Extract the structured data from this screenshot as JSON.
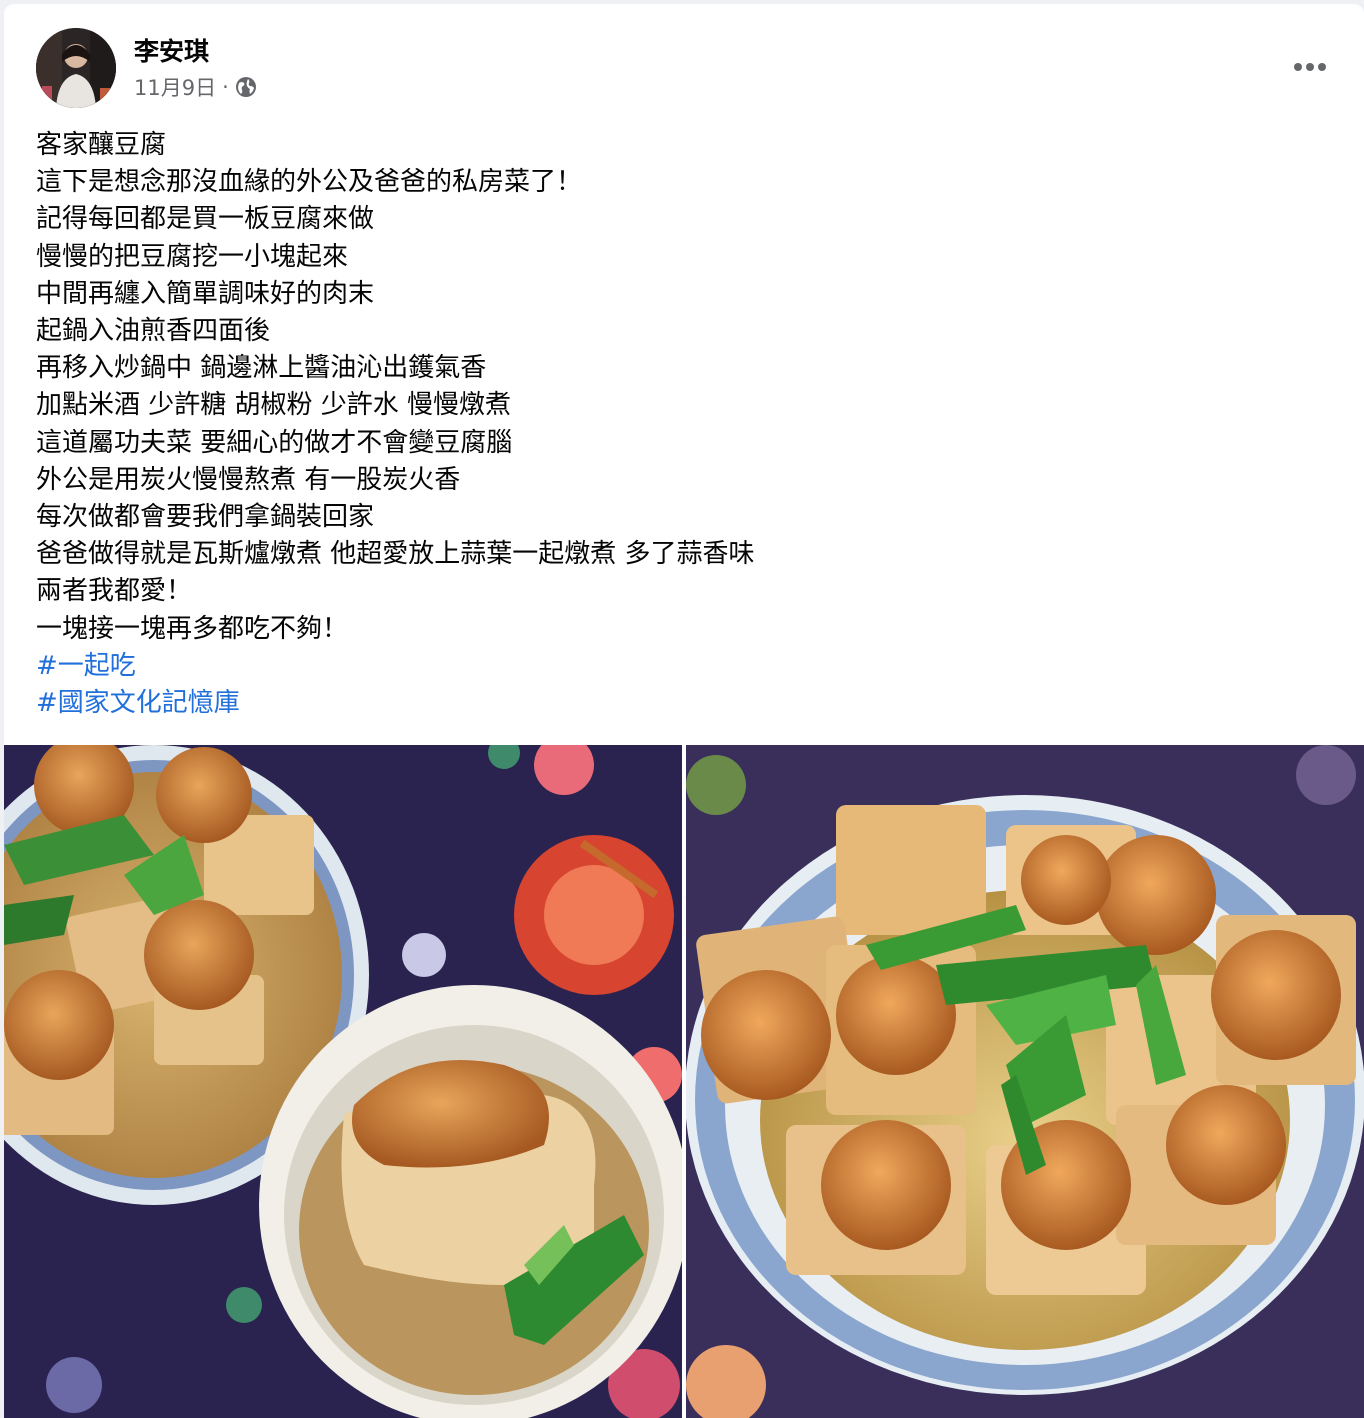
{
  "post": {
    "author": "李安琪",
    "date": "11月9日",
    "separator": "·",
    "privacy_icon": "globe-icon",
    "more_icon": "more-options-icon",
    "lines": [
      "客家釀豆腐",
      "這下是想念那沒血緣的外公及爸爸的私房菜了！",
      "記得每回都是買一板豆腐來做",
      "慢慢的把豆腐挖一小塊起來",
      "中間再纏入簡單調味好的肉末",
      "起鍋入油煎香四面後",
      "再移入炒鍋中 鍋邊淋上醬油沁出鑊氣香",
      "加點米酒 少許糖 胡椒粉 少許水 慢慢燉煮",
      "這道屬功夫菜 要細心的做才不會變豆腐腦",
      "外公是用炭火慢慢熬煮 有一股炭火香",
      "每次做都會要我們拿鍋裝回家",
      "爸爸做得就是瓦斯爐燉煮 他超愛放上蒜葉一起燉煮 多了蒜香味",
      "兩者我都愛！",
      "一塊接一塊再多都吃不夠！"
    ],
    "hashtags": [
      "#一起吃",
      "#國家文化記憶庫"
    ]
  },
  "colors": {
    "text_primary": "#050505",
    "text_secondary": "#65676b",
    "hashtag_link": "#216fdb",
    "card_background": "#ffffff",
    "page_background": "#eef0f3"
  }
}
